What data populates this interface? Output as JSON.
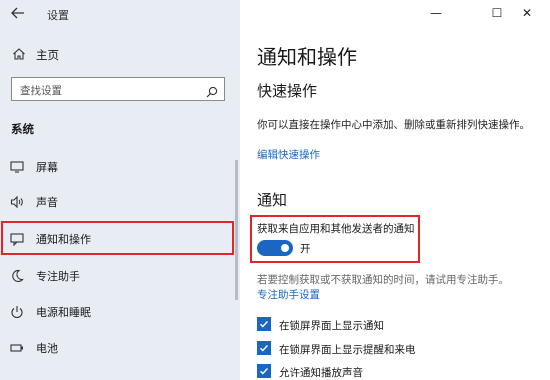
{
  "window": {
    "title": "设置",
    "back_icon": "arrow-left-icon",
    "controls": {
      "minimize": "—",
      "maximize": "☐",
      "close": "✕"
    }
  },
  "sidebar": {
    "home_label": "主页",
    "search_placeholder": "查找设置",
    "section_label": "系统",
    "items": [
      {
        "label": "屏幕",
        "icon": "monitor-icon"
      },
      {
        "label": "声音",
        "icon": "speaker-icon"
      },
      {
        "label": "通知和操作",
        "icon": "notification-icon",
        "selected": true
      },
      {
        "label": "专注助手",
        "icon": "moon-icon"
      },
      {
        "label": "电源和睡眠",
        "icon": "power-icon"
      },
      {
        "label": "电池",
        "icon": "battery-icon"
      }
    ]
  },
  "main": {
    "title": "通知和操作",
    "quick_actions": {
      "heading": "快速操作",
      "description": "你可以直接在操作中心中添加、删除或重新排列快速操作。",
      "link": "编辑快速操作"
    },
    "notifications": {
      "heading": "通知",
      "get_notifications_label": "获取来自应用和其他发送者的通知",
      "toggle_state": "开",
      "toggle_on": true,
      "focus_hint": "若要控制获取或不获取通知的时间，请试用专注助手。",
      "focus_link": "专注助手设置",
      "checkboxes": [
        {
          "label": "在锁屏界面上显示通知",
          "checked": true
        },
        {
          "label": "在锁屏界面上显示提醒和来电",
          "checked": true
        },
        {
          "label": "允许通知播放声音",
          "checked": true
        }
      ]
    }
  },
  "colors": {
    "accent": "#1a66c2",
    "highlight_border": "#e3242b",
    "sidebar_bg": "#e8edf3"
  }
}
